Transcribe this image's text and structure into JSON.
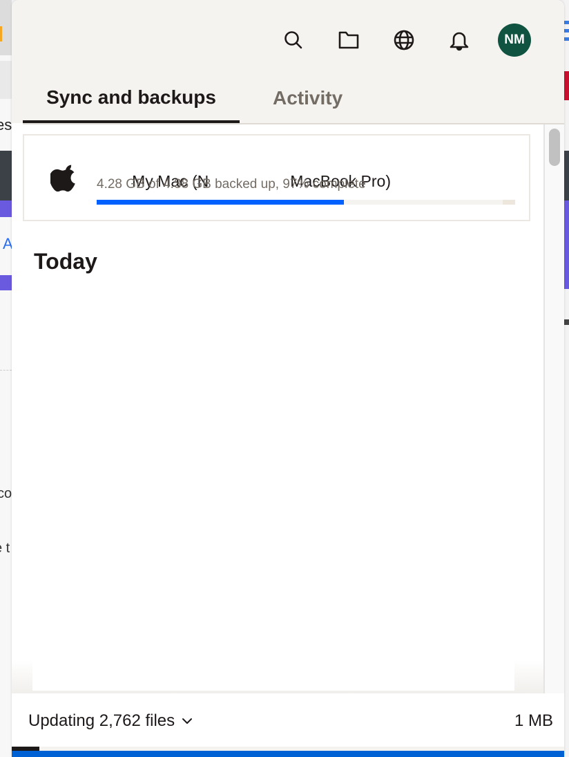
{
  "header": {
    "icons": {
      "search": "search-icon",
      "folder": "folder-icon",
      "globe": "globe-icon",
      "notifications": "bell-icon"
    },
    "avatar_initials": "NM",
    "avatar_color": "#0f5340"
  },
  "tabs": [
    {
      "label": "Sync and backups",
      "active": true
    },
    {
      "label": "Activity",
      "active": false
    }
  ],
  "backup": {
    "device_icon": "apple-icon",
    "title_start": "My Mac (N",
    "title_end": "MacBook Pro)",
    "status": "4.28 GB of 4.38 GB backed up, 97% complete",
    "progress_fraction": 0.59,
    "accent_color": "#0061fe"
  },
  "section": {
    "title": "Today"
  },
  "footer": {
    "status_label": "Updating 2,762 files",
    "size_label": "1 MB"
  }
}
